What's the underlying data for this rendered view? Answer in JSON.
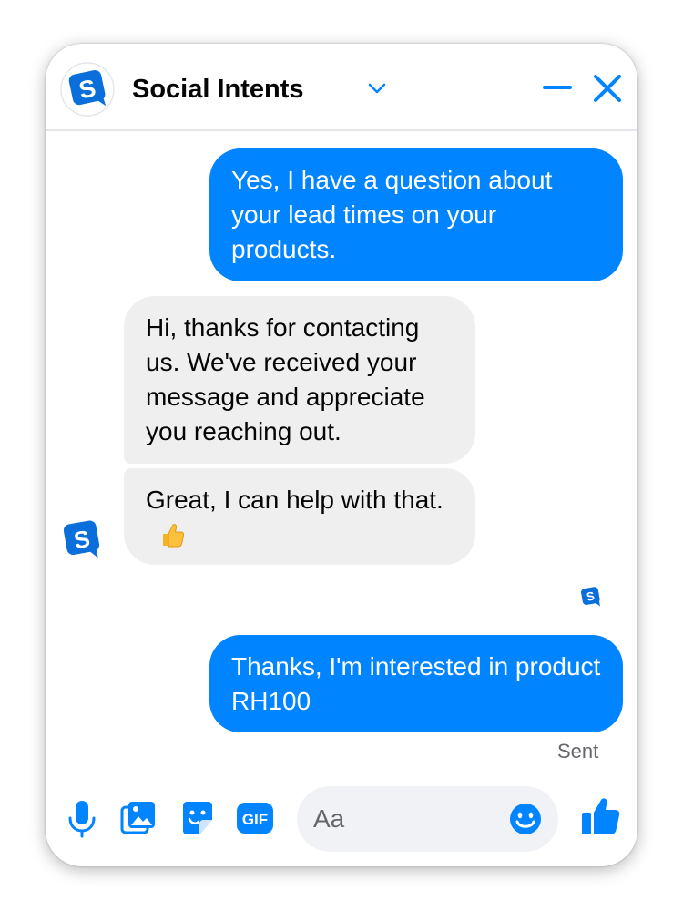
{
  "header": {
    "app_name": "Social Intents",
    "logo_icon": "social-intents-logo",
    "dropdown_icon": "chevron-down-icon",
    "minimize_icon": "minimize-icon",
    "close_icon": "close-icon"
  },
  "messages": [
    {
      "direction": "outgoing",
      "text": "Yes, I have a question about your lead times on your products."
    },
    {
      "direction": "incoming",
      "text": "Hi, thanks for contacting us. We've received your message and appreciate you reaching out."
    },
    {
      "direction": "incoming",
      "text": "Great,  I can help with that.",
      "emoji": "thumbs-up"
    },
    {
      "direction": "outgoing",
      "text": "Thanks, I'm interested in product RH100"
    }
  ],
  "status": {
    "sent_label": "Sent"
  },
  "composer": {
    "placeholder": "Aa",
    "icons": [
      "microphone-icon",
      "image-icon",
      "sticker-icon",
      "gif-icon",
      "emoji-icon",
      "thumbs-up-icon"
    ],
    "gif_label": "GIF"
  },
  "colors": {
    "accent": "#0084ff",
    "incoming_bubble": "#efefef",
    "outgoing_text": "#ffffff",
    "border": "#e4e6eb",
    "muted_text": "#65676b"
  }
}
